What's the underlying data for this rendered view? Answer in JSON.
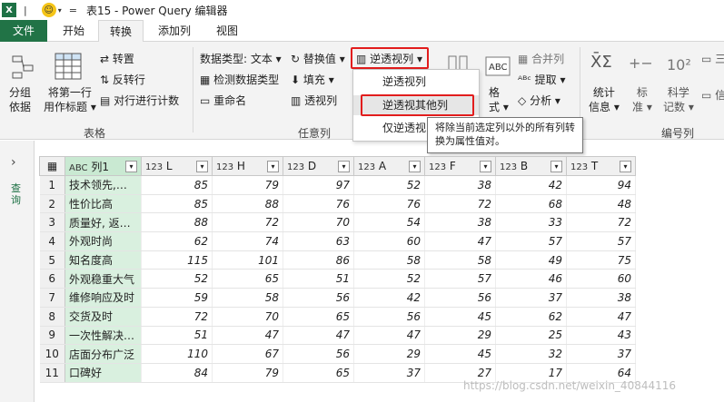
{
  "titlebar": {
    "excel_icon": "X",
    "title": "表15 - Power Query 编辑器",
    "qat_sep": "|",
    "qat_eq": "="
  },
  "tabs": [
    "文件",
    "开始",
    "转换",
    "添加列",
    "视图"
  ],
  "ribbon": {
    "group_table": {
      "label": "表格",
      "group_by": [
        "分组",
        "依据"
      ],
      "first_row_header": [
        "将第一行",
        "用作标题"
      ],
      "transpose": "转置",
      "reverse_rows": "反转行",
      "count_rows": "对行进行计数"
    },
    "group_anycol": {
      "label": "任意列",
      "data_type": "数据类型: 文本",
      "detect_type": "检测数据类型",
      "rename": "重命名",
      "replace_values": "替换值",
      "fill": "填充",
      "pivot": "透视列",
      "unpivot": "逆透视列",
      "move_to": "仅逆透视"
    },
    "group_text": {
      "format": "格",
      "format2": "式",
      "merge_cols": "合并列",
      "extract": "提取",
      "parse": "分析"
    },
    "group_number": {
      "label": "编号列",
      "statistics": [
        "统计",
        "信息"
      ],
      "standard": [
        "标",
        "准"
      ],
      "scientific": [
        "科学",
        "记数"
      ],
      "trig": "三",
      "info": "信"
    }
  },
  "dropdown": {
    "items": [
      "逆透视列",
      "逆透视其他列",
      "仅逆透视"
    ]
  },
  "tooltip": {
    "text": "将除当前选定列以外的所有列转换为属性值对。"
  },
  "left_pane": {
    "label": "查询",
    "arrow": "›"
  },
  "table": {
    "type_text": "ABC",
    "type_num": "123",
    "columns": [
      "列1",
      "L",
      "H",
      "D",
      "A",
      "F",
      "B",
      "T"
    ],
    "rows": [
      [
        "1",
        "技术领先,…",
        "85",
        "79",
        "97",
        "52",
        "38",
        "42",
        "94"
      ],
      [
        "2",
        "性价比高",
        "85",
        "88",
        "76",
        "76",
        "72",
        "68",
        "48"
      ],
      [
        "3",
        "质量好, 返…",
        "88",
        "72",
        "70",
        "54",
        "38",
        "33",
        "72"
      ],
      [
        "4",
        "外观时尚",
        "62",
        "74",
        "63",
        "60",
        "47",
        "57",
        "57"
      ],
      [
        "5",
        "知名度高",
        "115",
        "101",
        "86",
        "58",
        "58",
        "49",
        "75"
      ],
      [
        "6",
        "外观稳重大气",
        "52",
        "65",
        "51",
        "52",
        "57",
        "46",
        "60"
      ],
      [
        "7",
        "维修响应及时",
        "59",
        "58",
        "56",
        "42",
        "56",
        "37",
        "38"
      ],
      [
        "8",
        "交货及时",
        "72",
        "70",
        "65",
        "56",
        "45",
        "62",
        "47"
      ],
      [
        "9",
        "一次性解决…",
        "51",
        "47",
        "47",
        "47",
        "29",
        "25",
        "43"
      ],
      [
        "10",
        "店面分布广泛",
        "110",
        "67",
        "56",
        "29",
        "45",
        "32",
        "37"
      ],
      [
        "11",
        "口碑好",
        "84",
        "79",
        "65",
        "37",
        "27",
        "17",
        "64"
      ]
    ]
  },
  "watermark": "https://blog.csdn.net/weixin_40844116",
  "colors": {
    "file_tab": "#217346",
    "highlight": "#e21d1d",
    "text_col": "#d9f0df"
  }
}
